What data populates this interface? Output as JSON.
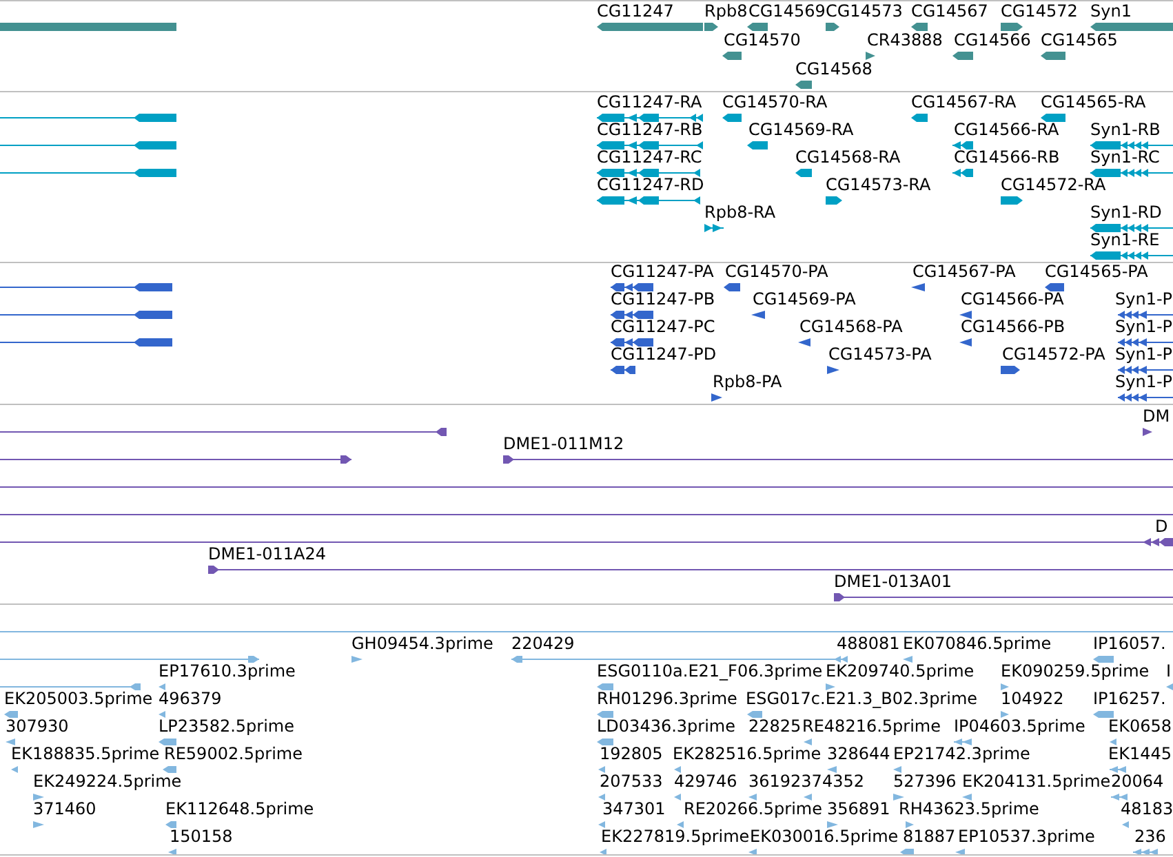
{
  "tracks": [
    {
      "kind": "gene",
      "rows": [
        {
          "features": [
            {
              "kind": "box"
            },
            {
              "label": "CG11247",
              "kind": "box",
              "reverse": true
            },
            {
              "label": "Rpb8",
              "kind": "box",
              "reverse": false
            },
            {
              "label": "CG14569",
              "kind": "box",
              "reverse": true
            },
            {
              "label": "CG14573",
              "kind": "box",
              "reverse": false
            },
            {
              "label": "CG14567",
              "kind": "box",
              "reverse": true
            },
            {
              "label": "CG14572",
              "kind": "box",
              "reverse": false
            },
            {
              "label": "Syn1",
              "kind": "box",
              "reverse": true
            }
          ]
        },
        {
          "features": [
            {
              "label": "CG14570",
              "kind": "box",
              "reverse": true
            },
            {
              "label": "CR43888",
              "kind": "arrow",
              "reverse": false
            },
            {
              "label": "CG14566",
              "kind": "box",
              "reverse": true
            },
            {
              "label": "CG14565",
              "kind": "box",
              "reverse": true
            }
          ]
        },
        {
          "features": [
            {
              "label": "CG14568",
              "kind": "box",
              "reverse": true
            }
          ]
        }
      ]
    },
    {
      "kind": "transcript",
      "rows": [
        {
          "features": [
            {
              "kind": "exons",
              "reverse": true
            },
            {
              "label": "CG11247-RA",
              "kind": "exons",
              "reverse": true
            },
            {
              "label": "CG14570-RA",
              "kind": "box",
              "reverse": true
            },
            {
              "label": "CG14567-RA",
              "kind": "box",
              "reverse": true
            },
            {
              "label": "CG14565-RA",
              "kind": "box",
              "reverse": true
            }
          ]
        },
        {
          "features": [
            {
              "kind": "exons",
              "reverse": true
            },
            {
              "label": "CG11247-RB",
              "kind": "exons",
              "reverse": true
            },
            {
              "label": "CG14569-RA",
              "kind": "box",
              "reverse": true
            },
            {
              "label": "CG14566-RA",
              "kind": "exons",
              "reverse": true
            },
            {
              "label": "Syn1-RB",
              "kind": "exons",
              "reverse": true
            }
          ]
        },
        {
          "features": [
            {
              "kind": "exons",
              "reverse": true
            },
            {
              "label": "CG11247-RC",
              "kind": "exons",
              "reverse": true
            },
            {
              "label": "CG14568-RA",
              "kind": "box",
              "reverse": true
            },
            {
              "label": "CG14566-RB",
              "kind": "exons",
              "reverse": true
            },
            {
              "label": "Syn1-RC",
              "kind": "exons",
              "reverse": true
            }
          ]
        },
        {
          "features": [
            {
              "label": "CG11247-RD",
              "kind": "exons",
              "reverse": true
            },
            {
              "label": "CG14573-RA",
              "kind": "box",
              "reverse": false
            },
            {
              "label": "CG14572-RA",
              "kind": "box",
              "reverse": false
            }
          ]
        },
        {
          "features": [
            {
              "label": "Rpb8-RA",
              "kind": "exons",
              "reverse": false
            },
            {
              "label": "Syn1-RD",
              "kind": "exons",
              "reverse": true
            }
          ]
        },
        {
          "features": [
            {
              "label": "Syn1-RE",
              "kind": "exons",
              "reverse": true
            }
          ]
        }
      ]
    },
    {
      "kind": "polypeptide",
      "rows": [
        {
          "features": [
            {
              "kind": "exons",
              "reverse": true
            },
            {
              "label": "CG11247-PA",
              "kind": "exons",
              "reverse": true
            },
            {
              "label": "CG14570-PA",
              "kind": "box",
              "reverse": true
            },
            {
              "label": "CG14567-PA",
              "kind": "arrow",
              "reverse": true
            },
            {
              "label": "CG14565-PA",
              "kind": "box",
              "reverse": true
            }
          ]
        },
        {
          "features": [
            {
              "kind": "exons",
              "reverse": true
            },
            {
              "label": "CG11247-PB",
              "kind": "exons",
              "reverse": true
            },
            {
              "label": "CG14569-PA",
              "kind": "arrow",
              "reverse": true
            },
            {
              "label": "CG14566-PA",
              "kind": "arrow",
              "reverse": true
            },
            {
              "label": "Syn1-P",
              "kind": "exons",
              "reverse": true
            }
          ]
        },
        {
          "features": [
            {
              "kind": "exons",
              "reverse": true
            },
            {
              "label": "CG11247-PC",
              "kind": "exons",
              "reverse": true
            },
            {
              "label": "CG14568-PA",
              "kind": "arrow",
              "reverse": true
            },
            {
              "label": "CG14566-PB",
              "kind": "arrow",
              "reverse": true
            },
            {
              "label": "Syn1-P",
              "kind": "exons",
              "reverse": true
            }
          ]
        },
        {
          "features": [
            {
              "label": "CG11247-PD",
              "kind": "exons",
              "reverse": true
            },
            {
              "label": "CG14573-PA",
              "kind": "arrow",
              "reverse": false
            },
            {
              "label": "CG14572-PA",
              "kind": "box",
              "reverse": false
            },
            {
              "label": "Syn1-P",
              "kind": "exons",
              "reverse": true
            }
          ]
        },
        {
          "features": [
            {
              "label": "Rpb8-PA",
              "kind": "arrow",
              "reverse": false
            },
            {
              "label": "Syn1-P",
              "kind": "exons",
              "reverse": true
            }
          ]
        }
      ]
    },
    {
      "kind": "clone",
      "rows": [
        {
          "features": [
            {
              "kind": "line",
              "reverse": true
            },
            {
              "label": "DM",
              "kind": "arrow",
              "reverse": false
            }
          ]
        },
        {
          "features": [
            {
              "kind": "line",
              "reverse": false
            },
            {
              "label": "DME1-011M12",
              "kind": "line",
              "reverse": false
            }
          ]
        },
        {
          "features": [
            {
              "kind": "line"
            }
          ]
        },
        {
          "features": [
            {
              "kind": "line"
            }
          ]
        },
        {
          "features": [
            {
              "kind": "line"
            },
            {
              "label": "D",
              "kind": "exons",
              "reverse": true
            }
          ]
        },
        {
          "features": [
            {
              "label": "DME1-011A24",
              "kind": "line",
              "reverse": false
            }
          ]
        },
        {
          "features": [
            {
              "label": "DME1-013A01",
              "kind": "line",
              "reverse": false
            }
          ]
        }
      ]
    },
    {
      "kind": "est",
      "rows": [
        {
          "features": [
            {
              "kind": "line"
            }
          ]
        },
        {
          "features": [
            {
              "kind": "line",
              "reverse": false
            },
            {
              "label": "GH09454.3prime",
              "kind": "arrow",
              "reverse": false
            },
            {
              "label": "220429",
              "kind": "line",
              "reverse": true
            },
            {
              "label": "488081",
              "kind": "exons",
              "reverse": true
            },
            {
              "label": "EK070846.5prime",
              "kind": "arrow",
              "reverse": true
            },
            {
              "label": "IP16057.",
              "kind": "box",
              "reverse": true
            }
          ]
        },
        {
          "features": [
            {
              "kind": "line",
              "reverse": true
            },
            {
              "label": "EP17610.3prime",
              "kind": "arrow",
              "reverse": true
            },
            {
              "label": "ESG0110a.E21_F06.3prime",
              "kind": "box",
              "reverse": true
            },
            {
              "label": "EK209740.5prime",
              "kind": "arrow",
              "reverse": false
            },
            {
              "label": "EK090259.5prime",
              "kind": "arrow",
              "reverse": false
            },
            {
              "label": "I",
              "kind": "arrow",
              "reverse": true
            }
          ]
        },
        {
          "features": [
            {
              "label": "EK205003.5prime",
              "kind": "box",
              "reverse": true
            },
            {
              "label": "496379",
              "kind": "arrow",
              "reverse": true
            },
            {
              "label": "RH01296.3prime",
              "kind": "box",
              "reverse": true
            },
            {
              "label": "ESG017c.E21.3_B02.3prime",
              "kind": "box",
              "reverse": true
            },
            {
              "label": "104922",
              "kind": "arrow",
              "reverse": false
            },
            {
              "label": "IP16257.",
              "kind": "box",
              "reverse": true
            }
          ]
        },
        {
          "features": [
            {
              "label": "307930",
              "kind": "arrow",
              "reverse": true
            },
            {
              "label": "LP23582.5prime",
              "kind": "box",
              "reverse": true
            },
            {
              "label": "LD03436.3prime",
              "kind": "box",
              "reverse": true
            },
            {
              "label": "22825"
            },
            {
              "label": "RE48216.5prime",
              "kind": "arrow",
              "reverse": true
            },
            {
              "label": "IP04603.5prime",
              "kind": "exons",
              "reverse": true
            },
            {
              "label": "EK0658",
              "kind": "arrow",
              "reverse": true
            }
          ]
        },
        {
          "features": [
            {
              "label": "EK188835.5prime",
              "kind": "arrow",
              "reverse": true
            },
            {
              "label": "RE59002.5prime",
              "kind": "box",
              "reverse": true
            },
            {
              "label": "192805",
              "kind": "arrow",
              "reverse": true
            },
            {
              "label": "EK282516.5prime",
              "kind": "arrow",
              "reverse": true
            },
            {
              "label": "328644",
              "kind": "arrow",
              "reverse": true
            },
            {
              "label": "EP21742.3prime",
              "kind": "arrow",
              "reverse": true
            },
            {
              "label": "EK1445",
              "kind": "exons",
              "reverse": true
            }
          ]
        },
        {
          "features": [
            {
              "label": "EK249224.5prime",
              "kind": "arrow",
              "reverse": false
            },
            {
              "label": "207533",
              "kind": "arrow",
              "reverse": true
            },
            {
              "label": "429746",
              "kind": "arrow",
              "reverse": true
            },
            {
              "label": "36192374352",
              "kind": "arrow",
              "reverse": true
            },
            {
              "kind": "arrow",
              "reverse": true
            },
            {
              "label": "527396",
              "kind": "arrow",
              "reverse": false
            },
            {
              "label": "EK204131.5prime",
              "kind": "arrow",
              "reverse": true
            },
            {
              "label": "20064",
              "kind": "exons",
              "reverse": true
            }
          ]
        },
        {
          "features": [
            {
              "label": "371460",
              "kind": "arrow",
              "reverse": false
            },
            {
              "label": "EK112648.5prime",
              "kind": "box",
              "reverse": true
            },
            {
              "label": "347301",
              "kind": "arrow",
              "reverse": true
            },
            {
              "label": "RE20266.5prime",
              "kind": "arrow",
              "reverse": true
            },
            {
              "label": "356891",
              "kind": "arrow",
              "reverse": false
            },
            {
              "label": "RH43623.5prime",
              "kind": "arrow",
              "reverse": false
            },
            {
              "label": "48183",
              "kind": "arrow",
              "reverse": true
            }
          ]
        },
        {
          "features": [
            {
              "label": "150158",
              "kind": "arrow",
              "reverse": true
            },
            {
              "label": "EK227819.5prime",
              "kind": "arrow",
              "reverse": true
            },
            {
              "label": "EK030016.5prime",
              "kind": "arrow",
              "reverse": true
            },
            {
              "label": "81887",
              "kind": "box",
              "reverse": true
            },
            {
              "label": "EP10537.3prime",
              "kind": "arrow",
              "reverse": true
            },
            {
              "label": "236",
              "kind": "exons",
              "reverse": true
            }
          ]
        }
      ]
    }
  ]
}
